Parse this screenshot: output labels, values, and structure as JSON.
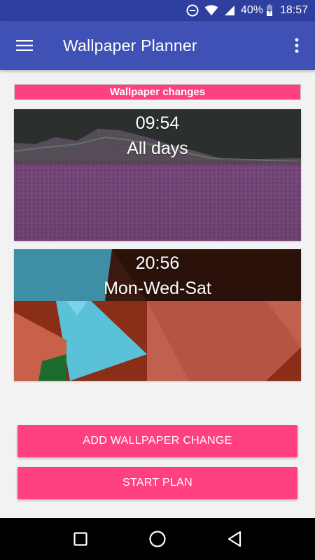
{
  "status_bar": {
    "battery_percent": "40%",
    "time": "18:57",
    "icons": [
      "do-not-disturb-icon",
      "wifi-icon",
      "signal-icon",
      "charging-icon"
    ]
  },
  "app_bar": {
    "title": "Wallpaper Planner",
    "menu_icon": "hamburger-menu-icon",
    "overflow_icon": "more-vert-icon"
  },
  "section": {
    "header": "Wallpaper changes"
  },
  "changes": [
    {
      "time": "09:54",
      "days": "All days"
    },
    {
      "time": "20:56",
      "days": "Mon-Wed-Sat"
    }
  ],
  "buttons": {
    "add_label": "ADD WALLPAPER CHANGE",
    "start_label": "START PLAN"
  },
  "nav": {
    "items": [
      "recents-square-icon",
      "home-circle-icon",
      "back-triangle-icon"
    ]
  },
  "colors": {
    "primary": "#3f51b5",
    "primary_dark": "#2f3fa0",
    "accent": "#ff4081"
  }
}
